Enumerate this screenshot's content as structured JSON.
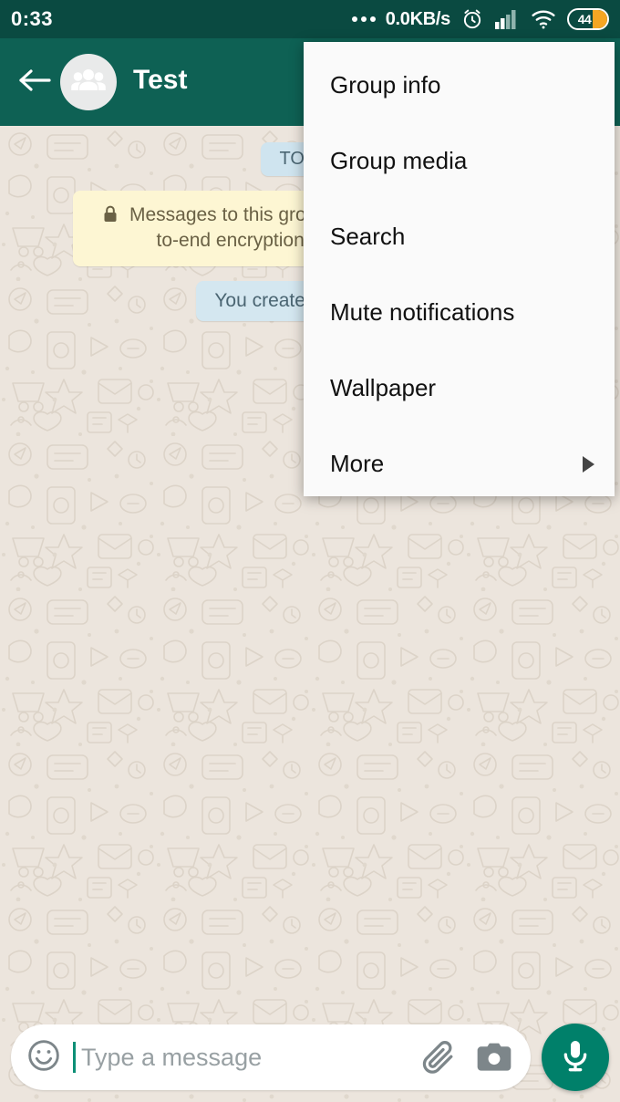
{
  "statusbar": {
    "clock": "0:33",
    "network_speed": "0.0KB/s",
    "battery_level": "44",
    "icons": {
      "overflow": "more-dots-icon",
      "alarm": "alarm-clock-icon",
      "signal": "cellular-signal-icon",
      "wifi": "wifi-icon",
      "battery": "battery-icon"
    },
    "bg_color": "#0a4a41"
  },
  "toolbar": {
    "back": "back-arrow-icon",
    "avatar": "group-avatar-icon",
    "title": "Test",
    "subtitle": "",
    "bg_color": "#0e6154"
  },
  "chat": {
    "bg_color": "#ece5dd",
    "day_badge": "TODAY",
    "encryption_notice": "Messages to this group are secured with end-to-end encryption. Tap for more info.",
    "encryption_lock": "lock-icon",
    "system_message": "You created this group",
    "badge_color": "#cfe4ef",
    "encryption_color": "#fdf6d3"
  },
  "menu": {
    "items": [
      {
        "label": "Group info",
        "has_submenu": false
      },
      {
        "label": "Group media",
        "has_submenu": false
      },
      {
        "label": "Search",
        "has_submenu": false
      },
      {
        "label": "Mute notifications",
        "has_submenu": false
      },
      {
        "label": "Wallpaper",
        "has_submenu": false
      },
      {
        "label": "More",
        "has_submenu": true
      }
    ],
    "bg_color": "#fafafa"
  },
  "input": {
    "emoji_icon": "emoji-smiley-icon",
    "placeholder": "Type a message",
    "value": "",
    "attach_icon": "paperclip-icon",
    "camera_icon": "camera-icon",
    "mic_icon": "microphone-icon",
    "mic_color": "#00806a"
  }
}
